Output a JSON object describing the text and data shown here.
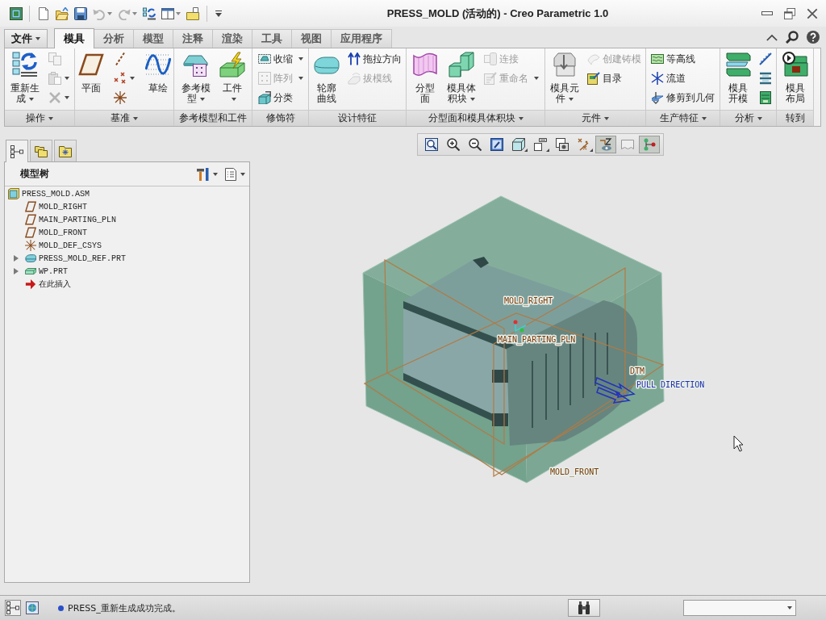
{
  "window": {
    "title": "PRESS_MOLD (活动的) - Creo Parametric 1.0"
  },
  "quick_access": [
    {
      "disabled": false,
      "has_menu": false
    },
    {
      "disabled": false,
      "has_menu": false
    },
    {
      "disabled": false,
      "has_menu": false
    },
    {
      "disabled": true,
      "has_menu": true
    },
    {
      "disabled": true,
      "has_menu": true
    },
    {
      "disabled": false,
      "has_menu": false
    },
    {
      "disabled": false,
      "has_menu": true
    },
    {
      "disabled": false,
      "has_menu": false
    }
  ],
  "file_menu": {
    "label": "文件"
  },
  "tabs": [
    {
      "label": "模具",
      "selected": true
    },
    {
      "label": "分析",
      "selected": false
    },
    {
      "label": "模型",
      "selected": false
    },
    {
      "label": "注释",
      "selected": false
    },
    {
      "label": "渲染",
      "selected": false
    },
    {
      "label": "工具",
      "selected": false
    },
    {
      "label": "视图",
      "selected": false
    },
    {
      "label": "应用程序",
      "selected": false
    }
  ],
  "ribbon_groups": [
    {
      "label": "操作",
      "has_menu": true,
      "items": [
        {
          "kind": "large",
          "label": "重新生成",
          "has_menu": true,
          "disabled": false
        },
        {
          "kind": "icon",
          "disabled": true
        },
        {
          "kind": "dropdown",
          "disabled": true
        },
        {
          "kind": "dropdown",
          "disabled": true
        }
      ]
    },
    {
      "label": "基准",
      "has_menu": true,
      "items": [
        {
          "kind": "large",
          "label": "平面",
          "has_menu": false,
          "disabled": false
        },
        {
          "kind": "icon",
          "disabled": false
        },
        {
          "kind": "dropdown",
          "disabled": false
        },
        {
          "kind": "icon",
          "disabled": false
        },
        {
          "kind": "large",
          "label": "草绘",
          "has_menu": false,
          "disabled": false
        }
      ]
    },
    {
      "label": "参考模型和工件",
      "has_menu": false,
      "items": [
        {
          "kind": "large",
          "label": "参考模型",
          "has_menu": true,
          "disabled": false
        },
        {
          "kind": "large",
          "label": "工件",
          "has_menu": true,
          "disabled": false
        }
      ]
    },
    {
      "label": "修饰符",
      "has_menu": false,
      "items": [
        {
          "kind": "small",
          "label": "收缩",
          "has_menu": true,
          "disabled": false
        },
        {
          "kind": "small",
          "label": "阵列",
          "has_menu": true,
          "disabled": true
        },
        {
          "kind": "small",
          "label": "分类",
          "has_menu": false,
          "disabled": false
        }
      ]
    },
    {
      "label": "设计特征",
      "has_menu": false,
      "items": [
        {
          "kind": "large",
          "label": "轮廓曲线",
          "has_menu": false,
          "disabled": false
        },
        {
          "kind": "small",
          "label": "拖拉方向",
          "has_menu": false,
          "disabled": false
        },
        {
          "kind": "small",
          "label": "拔模线",
          "has_menu": false,
          "disabled": true
        }
      ]
    },
    {
      "label": "分型面和模具体积块",
      "has_menu": true,
      "items": [
        {
          "kind": "large",
          "label": "分型面",
          "has_menu": false,
          "disabled": false
        },
        {
          "kind": "large",
          "label": "模具体积块",
          "has_menu": true,
          "disabled": false
        },
        {
          "kind": "small",
          "label": "连接",
          "has_menu": false,
          "disabled": true
        },
        {
          "kind": "small",
          "label": "重命名",
          "has_menu": true,
          "disabled": true
        }
      ]
    },
    {
      "label": "元件",
      "has_menu": true,
      "items": [
        {
          "kind": "large",
          "label": "模具元件",
          "has_menu": true,
          "disabled": false
        },
        {
          "kind": "small",
          "label": "创建铸模",
          "has_menu": false,
          "disabled": true
        },
        {
          "kind": "small",
          "label": "目录",
          "has_menu": false,
          "disabled": false
        }
      ]
    },
    {
      "label": "生产特征",
      "has_menu": true,
      "items": [
        {
          "kind": "small",
          "label": "等高线",
          "has_menu": false,
          "disabled": false
        },
        {
          "kind": "small",
          "label": "流道",
          "has_menu": false,
          "disabled": false
        },
        {
          "kind": "small",
          "label": "修剪到几何",
          "has_menu": false,
          "disabled": false
        }
      ]
    },
    {
      "label": "分析",
      "has_menu": true,
      "items": [
        {
          "kind": "large",
          "label": "模具开模",
          "has_menu": false,
          "disabled": false
        },
        {
          "kind": "icon",
          "disabled": false
        },
        {
          "kind": "icon",
          "disabled": false
        },
        {
          "kind": "icon",
          "disabled": false
        }
      ]
    },
    {
      "label": "转到",
      "has_menu": false,
      "items": [
        {
          "kind": "large",
          "label": "模具布局",
          "has_menu": false,
          "disabled": false
        }
      ]
    }
  ],
  "navigator": {
    "tabs": [
      {
        "selected": true
      },
      {
        "selected": false
      },
      {
        "selected": false
      }
    ],
    "title": "模型树",
    "tree": {
      "label": "PRESS_MOLD.ASM",
      "kind": "assembly",
      "children": [
        {
          "label": "MOLD_RIGHT",
          "kind": "plane"
        },
        {
          "label": "MAIN_PARTING_PLN",
          "kind": "plane"
        },
        {
          "label": "MOLD_FRONT",
          "kind": "plane"
        },
        {
          "label": "MOLD_DEF_CSYS",
          "kind": "csys"
        },
        {
          "label": "PRESS_MOLD_REF.PRT",
          "kind": "part",
          "expanded": false
        },
        {
          "label": "WP.PRT",
          "kind": "workpiece",
          "expanded": false
        },
        {
          "label": "在此插入",
          "kind": "insert"
        }
      ]
    }
  },
  "graphics_toolbar": [
    {
      "pressed": false,
      "has_menu": false
    },
    {
      "pressed": false,
      "has_menu": false
    },
    {
      "pressed": false,
      "has_menu": false
    },
    {
      "pressed": false,
      "has_menu": false
    },
    {
      "pressed": false,
      "has_menu": true
    },
    {
      "pressed": false,
      "has_menu": true
    },
    {
      "pressed": false,
      "has_menu": false
    },
    {
      "pressed": false,
      "has_menu": true
    },
    {
      "pressed": true,
      "has_menu": false
    },
    {
      "pressed": false,
      "has_menu": false
    },
    {
      "pressed": true,
      "has_menu": false
    }
  ],
  "viewport": {
    "datum_labels": [
      "MOLD_RIGHT",
      "MAIN_PARTING_PLN",
      "MOLD_FRONT",
      "DTM"
    ],
    "pull_direction": "PULL DIRECTION"
  },
  "status_bar": {
    "toggles": [
      {
        "on": true
      },
      {
        "on": false
      }
    ],
    "message": "PRESS_重新生成成功完成。"
  }
}
